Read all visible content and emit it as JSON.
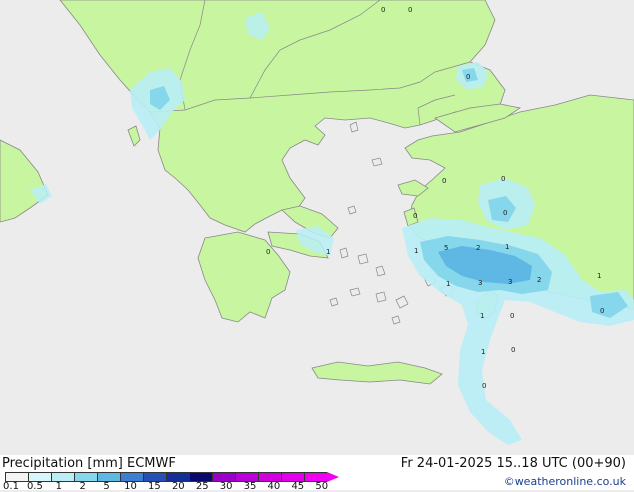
{
  "map": {
    "colors": {
      "sea": "#ececec",
      "land": "#c8f5a0",
      "border": "#888888",
      "precip_light": "#b9eef6",
      "precip_mid": "#86d6ec",
      "precip_heavy": "#5fb8e4"
    },
    "point_labels": [
      {
        "text": "0",
        "name": "value-label-bulgaria-1"
      },
      {
        "text": "0",
        "name": "value-label-bulgaria-2"
      },
      {
        "text": "0",
        "name": "value-label-istanbul"
      },
      {
        "text": "0",
        "name": "value-label-lesbos"
      },
      {
        "text": "0",
        "name": "value-label-anatolia-north"
      },
      {
        "text": "0",
        "name": "value-label-chios"
      },
      {
        "text": "0",
        "name": "value-label-izmir"
      },
      {
        "text": "0",
        "name": "value-label-peloponnese"
      },
      {
        "text": "1",
        "name": "value-label-attica"
      },
      {
        "text": "1",
        "name": "value-label-samos"
      },
      {
        "text": "5",
        "name": "value-label-kusadasi"
      },
      {
        "text": "2",
        "name": "value-label-aydin"
      },
      {
        "text": "1",
        "name": "value-label-mugla-north"
      },
      {
        "text": "1",
        "name": "value-label-kos"
      },
      {
        "text": "3",
        "name": "value-label-bodrum"
      },
      {
        "text": "3",
        "name": "value-label-marmaris"
      },
      {
        "text": "2",
        "name": "value-label-fethiye"
      },
      {
        "text": "1",
        "name": "value-label-antalya-inland"
      },
      {
        "text": "0",
        "name": "value-label-antalya-coast"
      },
      {
        "text": "1",
        "name": "value-label-rhodes-north"
      },
      {
        "text": "0",
        "name": "value-label-rhodes-east"
      },
      {
        "text": "1",
        "name": "value-label-sea-south-1"
      },
      {
        "text": "0",
        "name": "value-label-sea-south-2"
      },
      {
        "text": "0",
        "name": "value-label-sea-south-3"
      }
    ]
  },
  "footer": {
    "title_left": "Precipitation [mm] ECMWF",
    "title_right": "Fr 24-01-2025 15..18 UTC (00+90)",
    "credit": "©weatheronline.co.uk",
    "scale": {
      "labels": [
        "0.1",
        "0.5",
        "1",
        "2",
        "5",
        "10",
        "15",
        "20",
        "25",
        "30",
        "35",
        "40",
        "45",
        "50"
      ],
      "colors": [
        "#f4f4f4",
        "#d8f6fa",
        "#b9eef6",
        "#86d6ec",
        "#5fb8e4",
        "#3a7fd0",
        "#2450b8",
        "#152f9a",
        "#0a0a6e",
        "#9a00c8",
        "#b800d8",
        "#d000e0",
        "#e000ea",
        "#f000f0"
      ]
    }
  }
}
